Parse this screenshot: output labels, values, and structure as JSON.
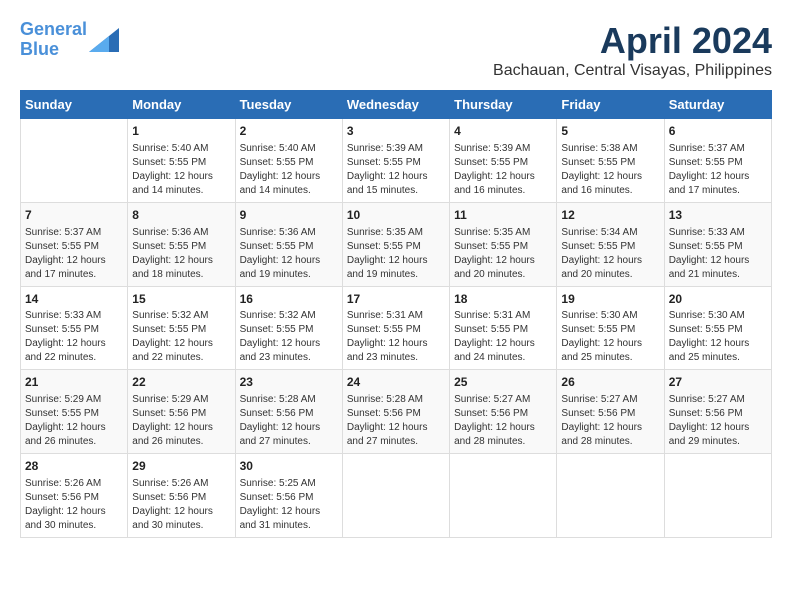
{
  "logo": {
    "line1": "General",
    "line2": "Blue"
  },
  "title": "April 2024",
  "location": "Bachauan, Central Visayas, Philippines",
  "days_of_week": [
    "Sunday",
    "Monday",
    "Tuesday",
    "Wednesday",
    "Thursday",
    "Friday",
    "Saturday"
  ],
  "weeks": [
    [
      {
        "day": "",
        "info": ""
      },
      {
        "day": "1",
        "info": "Sunrise: 5:40 AM\nSunset: 5:55 PM\nDaylight: 12 hours\nand 14 minutes."
      },
      {
        "day": "2",
        "info": "Sunrise: 5:40 AM\nSunset: 5:55 PM\nDaylight: 12 hours\nand 14 minutes."
      },
      {
        "day": "3",
        "info": "Sunrise: 5:39 AM\nSunset: 5:55 PM\nDaylight: 12 hours\nand 15 minutes."
      },
      {
        "day": "4",
        "info": "Sunrise: 5:39 AM\nSunset: 5:55 PM\nDaylight: 12 hours\nand 16 minutes."
      },
      {
        "day": "5",
        "info": "Sunrise: 5:38 AM\nSunset: 5:55 PM\nDaylight: 12 hours\nand 16 minutes."
      },
      {
        "day": "6",
        "info": "Sunrise: 5:37 AM\nSunset: 5:55 PM\nDaylight: 12 hours\nand 17 minutes."
      }
    ],
    [
      {
        "day": "7",
        "info": "Sunrise: 5:37 AM\nSunset: 5:55 PM\nDaylight: 12 hours\nand 17 minutes."
      },
      {
        "day": "8",
        "info": "Sunrise: 5:36 AM\nSunset: 5:55 PM\nDaylight: 12 hours\nand 18 minutes."
      },
      {
        "day": "9",
        "info": "Sunrise: 5:36 AM\nSunset: 5:55 PM\nDaylight: 12 hours\nand 19 minutes."
      },
      {
        "day": "10",
        "info": "Sunrise: 5:35 AM\nSunset: 5:55 PM\nDaylight: 12 hours\nand 19 minutes."
      },
      {
        "day": "11",
        "info": "Sunrise: 5:35 AM\nSunset: 5:55 PM\nDaylight: 12 hours\nand 20 minutes."
      },
      {
        "day": "12",
        "info": "Sunrise: 5:34 AM\nSunset: 5:55 PM\nDaylight: 12 hours\nand 20 minutes."
      },
      {
        "day": "13",
        "info": "Sunrise: 5:33 AM\nSunset: 5:55 PM\nDaylight: 12 hours\nand 21 minutes."
      }
    ],
    [
      {
        "day": "14",
        "info": "Sunrise: 5:33 AM\nSunset: 5:55 PM\nDaylight: 12 hours\nand 22 minutes."
      },
      {
        "day": "15",
        "info": "Sunrise: 5:32 AM\nSunset: 5:55 PM\nDaylight: 12 hours\nand 22 minutes."
      },
      {
        "day": "16",
        "info": "Sunrise: 5:32 AM\nSunset: 5:55 PM\nDaylight: 12 hours\nand 23 minutes."
      },
      {
        "day": "17",
        "info": "Sunrise: 5:31 AM\nSunset: 5:55 PM\nDaylight: 12 hours\nand 23 minutes."
      },
      {
        "day": "18",
        "info": "Sunrise: 5:31 AM\nSunset: 5:55 PM\nDaylight: 12 hours\nand 24 minutes."
      },
      {
        "day": "19",
        "info": "Sunrise: 5:30 AM\nSunset: 5:55 PM\nDaylight: 12 hours\nand 25 minutes."
      },
      {
        "day": "20",
        "info": "Sunrise: 5:30 AM\nSunset: 5:55 PM\nDaylight: 12 hours\nand 25 minutes."
      }
    ],
    [
      {
        "day": "21",
        "info": "Sunrise: 5:29 AM\nSunset: 5:55 PM\nDaylight: 12 hours\nand 26 minutes."
      },
      {
        "day": "22",
        "info": "Sunrise: 5:29 AM\nSunset: 5:56 PM\nDaylight: 12 hours\nand 26 minutes."
      },
      {
        "day": "23",
        "info": "Sunrise: 5:28 AM\nSunset: 5:56 PM\nDaylight: 12 hours\nand 27 minutes."
      },
      {
        "day": "24",
        "info": "Sunrise: 5:28 AM\nSunset: 5:56 PM\nDaylight: 12 hours\nand 27 minutes."
      },
      {
        "day": "25",
        "info": "Sunrise: 5:27 AM\nSunset: 5:56 PM\nDaylight: 12 hours\nand 28 minutes."
      },
      {
        "day": "26",
        "info": "Sunrise: 5:27 AM\nSunset: 5:56 PM\nDaylight: 12 hours\nand 28 minutes."
      },
      {
        "day": "27",
        "info": "Sunrise: 5:27 AM\nSunset: 5:56 PM\nDaylight: 12 hours\nand 29 minutes."
      }
    ],
    [
      {
        "day": "28",
        "info": "Sunrise: 5:26 AM\nSunset: 5:56 PM\nDaylight: 12 hours\nand 30 minutes."
      },
      {
        "day": "29",
        "info": "Sunrise: 5:26 AM\nSunset: 5:56 PM\nDaylight: 12 hours\nand 30 minutes."
      },
      {
        "day": "30",
        "info": "Sunrise: 5:25 AM\nSunset: 5:56 PM\nDaylight: 12 hours\nand 31 minutes."
      },
      {
        "day": "",
        "info": ""
      },
      {
        "day": "",
        "info": ""
      },
      {
        "day": "",
        "info": ""
      },
      {
        "day": "",
        "info": ""
      }
    ]
  ]
}
